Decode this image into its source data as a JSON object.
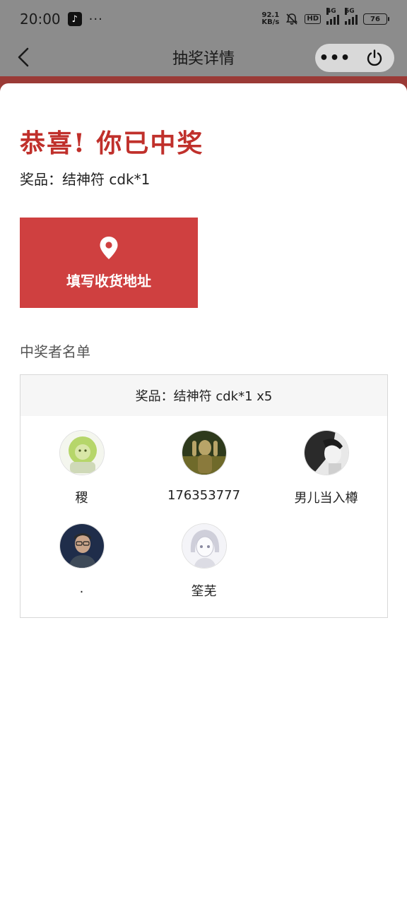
{
  "status_bar": {
    "time": "20:00",
    "app_glyph": "♪",
    "more_dots": "···",
    "net_speed_value": "92.1",
    "net_speed_unit": "KB/s",
    "hd_label": "HD",
    "signal1_label": "4G",
    "signal2_label": "5G",
    "battery": "76"
  },
  "nav": {
    "title": "抽奖详情",
    "more_glyph": "•••"
  },
  "result": {
    "title": "恭喜! 你已中奖",
    "prize_line": "奖品：结神符 cdk*1"
  },
  "address_button": {
    "label": "填写收货地址"
  },
  "winners": {
    "heading": "中奖者名单",
    "box_header": "奖品：结神符 cdk*1 x5",
    "items": [
      {
        "name": "稷",
        "avatar": "lion-illustration-avatar",
        "color": "#b6d66a"
      },
      {
        "name": "176353777",
        "avatar": "figure-on-green-avatar",
        "color": "#6f6a2a"
      },
      {
        "name": "男儿当入樽",
        "avatar": "bw-anime-avatar",
        "color": "#2a2a2a"
      },
      {
        "name": ".",
        "avatar": "man-with-glasses-avatar",
        "color": "#2c3e5c"
      },
      {
        "name": "筌芜",
        "avatar": "sketch-girl-avatar",
        "color": "#dcdce4"
      }
    ]
  },
  "colors": {
    "accent_red": "#c0302b",
    "button_red": "#cf4040"
  }
}
